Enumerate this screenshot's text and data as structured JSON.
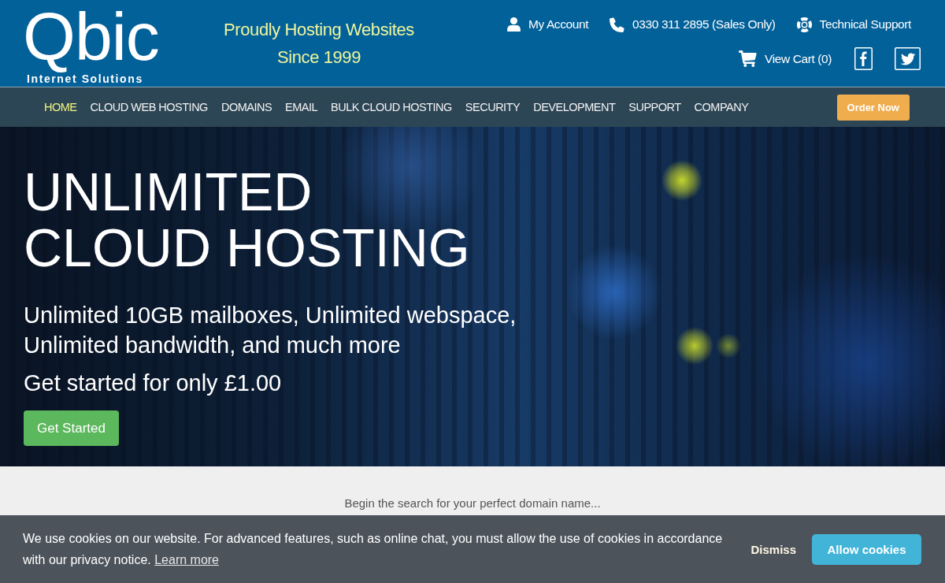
{
  "header": {
    "logo": {
      "wordmark": "Qbic",
      "subtitle": "Internet Solutions"
    },
    "tagline": [
      "Proudly Hosting Websites",
      "Since 1999"
    ],
    "top_links": [
      {
        "kind": "account",
        "label": "My Account"
      },
      {
        "kind": "phone",
        "label": "0330 311 2895 (Sales Only)"
      },
      {
        "kind": "support",
        "label": "Technical Support"
      }
    ],
    "cart_link": "View Cart (0)"
  },
  "nav": {
    "items": [
      {
        "label": "HOME",
        "selected": true
      },
      {
        "label": "CLOUD WEB HOSTING",
        "selected": false
      },
      {
        "label": "DOMAINS",
        "selected": false
      },
      {
        "label": "EMAIL",
        "selected": false
      },
      {
        "label": "BULK CLOUD HOSTING",
        "selected": false
      },
      {
        "label": "SECURITY",
        "selected": false
      },
      {
        "label": "DEVELOPMENT",
        "selected": false
      },
      {
        "label": "SUPPORT",
        "selected": false
      },
      {
        "label": "COMPANY",
        "selected": false
      }
    ],
    "order_button": "Order Now"
  },
  "hero": {
    "title": [
      "UNLIMITED",
      "CLOUD HOSTING"
    ],
    "subtitle": [
      "Unlimited 10GB mailboxes, Unlimited webspace,",
      "Unlimited bandwidth, and much more"
    ],
    "price_line": "Get started for only £1.00",
    "button": "Get Started"
  },
  "domain_search": {
    "prompt": "Begin the search for your perfect domain name..."
  },
  "cookie_banner": {
    "message": "We use cookies on our website. For advanced features, such as online chat, you must allow the use of cookies in accordance with our privacy notice.",
    "link": "Learn more",
    "dismiss": "Dismiss",
    "allow_button": "Allow cookies"
  }
}
